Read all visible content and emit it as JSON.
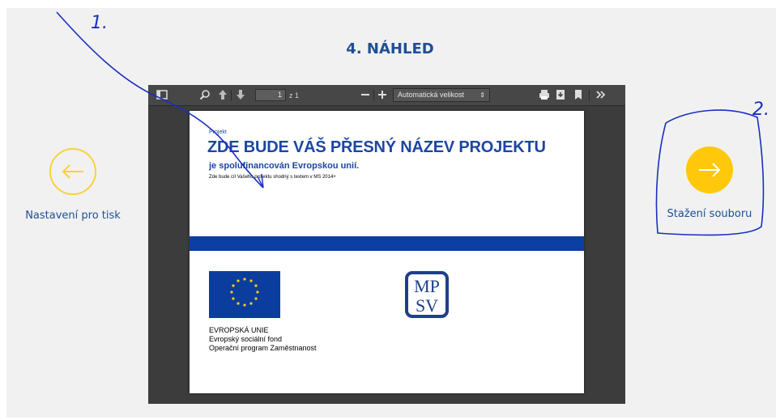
{
  "heading": "4. NÁHLED",
  "prev": {
    "label": "Nastavení pro tisk"
  },
  "next": {
    "label": "Stažení souboru"
  },
  "viewer": {
    "toolbar": {
      "page_current": "1",
      "page_of": "z 1",
      "zoom_value": "Automatická velikost"
    },
    "document": {
      "label": "Projekt",
      "title": "ZDE BUDE VÁŠ PŘESNÝ NÁZEV PROJEKTU",
      "subtitle": "je spolufinancován Evropskou unií.",
      "description": "Zde bude cíl Vašeho projektu shodný s textem v MS 2014+",
      "eu_lines": [
        "EVROPSKÁ UNIE",
        "Evropský sociální fond",
        "Operační program Zaměstnanost"
      ],
      "mpsv_logo": [
        "MP",
        "SV"
      ]
    }
  },
  "annotations": {
    "mark_1": "1.",
    "mark_2": "2."
  },
  "colors": {
    "accent_yellow": "#ffc80a",
    "heading_blue": "#1f4e96",
    "doc_blue": "#1c46a3",
    "toolbar": "#474747"
  }
}
